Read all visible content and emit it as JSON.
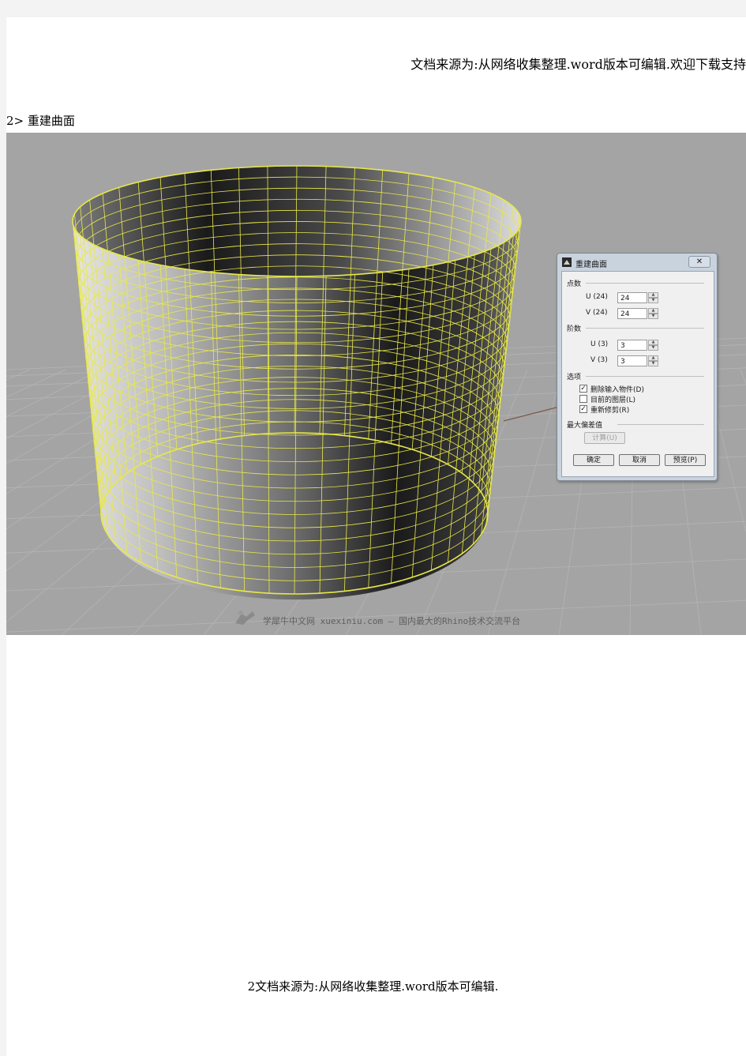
{
  "header": {
    "source_note": "文档来源为:从网络收集整理.word版本可编辑.欢迎下载支持"
  },
  "section": {
    "title": "2> 重建曲面"
  },
  "viewport": {
    "watermark": "学犀牛中文网 xuexiniu.com — 国内最大的Rhino技术交流平台"
  },
  "dialog": {
    "title": "重建曲面",
    "close_glyph": "✕",
    "group_points": "点数",
    "u_points_label": "U (24)",
    "u_points_value": "24",
    "v_points_label": "V (24)",
    "v_points_value": "24",
    "group_degree": "阶数",
    "u_degree_label": "U (3)",
    "u_degree_value": "3",
    "v_degree_label": "V (3)",
    "v_degree_value": "3",
    "group_options": "选项",
    "opt_delete_input": "删除输入物件(D)",
    "opt_delete_input_checked": true,
    "opt_current_layer": "目前的图层(L)",
    "opt_current_layer_checked": false,
    "opt_retrim": "重新修剪(R)",
    "opt_retrim_checked": true,
    "group_max_deviation": "最大偏差值",
    "calc_button": "计算(U)",
    "ok_button": "确定",
    "cancel_button": "取消",
    "preview_button": "预览(P)"
  },
  "footer": {
    "page_note": "2文档来源为:从网络收集整理.word版本可编辑."
  },
  "colors": {
    "wire": "#e8e84a",
    "viewport_bg": "#a4a4a4"
  }
}
